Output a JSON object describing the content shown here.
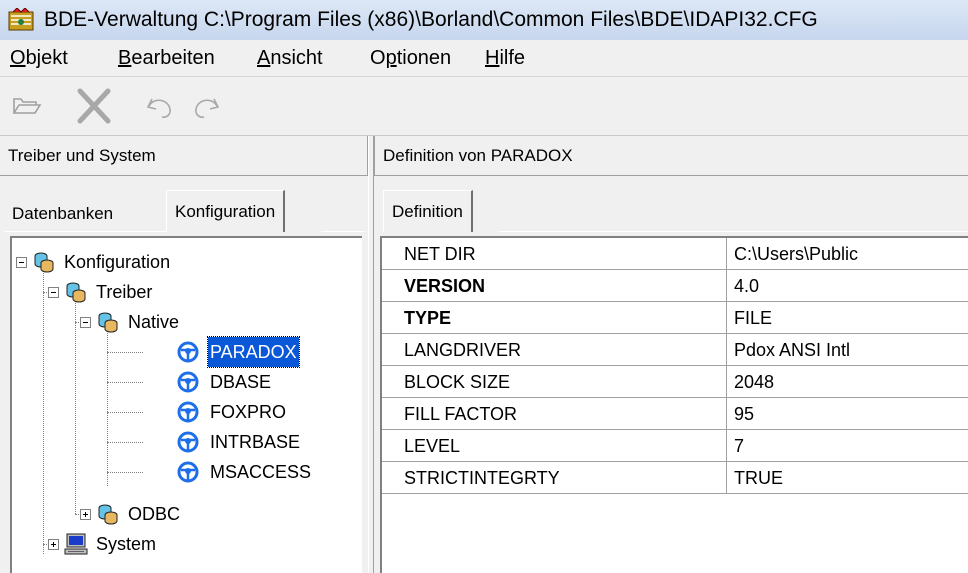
{
  "window": {
    "title": "BDE-Verwaltung  C:\\Program Files (x86)\\Borland\\Common Files\\BDE\\IDAPI32.CFG",
    "app_icon": "bde-app-icon"
  },
  "menu": [
    {
      "accel": "O",
      "rest": "bjekt"
    },
    {
      "accel": "B",
      "rest": "earbeiten"
    },
    {
      "accel": "A",
      "rest": "nsicht"
    },
    {
      "pre": "O",
      "accel": "p",
      "rest": "tionen"
    },
    {
      "accel": "H",
      "rest": "ilfe"
    }
  ],
  "toolbar": {
    "buttons": [
      {
        "name": "open-icon"
      },
      {
        "name": "delete-icon"
      },
      {
        "name": "undo-icon"
      },
      {
        "name": "redo-icon"
      }
    ]
  },
  "left_pane": {
    "header": "Treiber und System",
    "tabs": [
      {
        "label": "Datenbanken",
        "active": false
      },
      {
        "label": "Konfiguration",
        "active": true
      }
    ],
    "tree": [
      {
        "label": "Konfiguration",
        "icon": "database-icon",
        "level": 0,
        "expander": "minus"
      },
      {
        "label": "Treiber",
        "icon": "database-icon",
        "level": 1,
        "expander": "minus"
      },
      {
        "label": "Native",
        "icon": "database-icon",
        "level": 2,
        "expander": "minus"
      },
      {
        "label": "PARADOX",
        "icon": "driver-icon",
        "level": 3,
        "selected": true
      },
      {
        "label": "DBASE",
        "icon": "driver-icon",
        "level": 3
      },
      {
        "label": "FOXPRO",
        "icon": "driver-icon",
        "level": 3
      },
      {
        "label": "INTRBASE",
        "icon": "driver-icon",
        "level": 3
      },
      {
        "label": "MSACCESS",
        "icon": "driver-icon",
        "level": 3
      },
      {
        "label": "ODBC",
        "icon": "database-icon",
        "level": 2,
        "expander": "plus"
      },
      {
        "label": "System",
        "icon": "computer-icon",
        "level": 1,
        "expander": "plus"
      }
    ]
  },
  "right_pane": {
    "header": "Definition von PARADOX",
    "tab": "Definition",
    "rows": [
      {
        "name": "NET DIR",
        "value": "C:\\Users\\Public",
        "bold": false
      },
      {
        "name": "VERSION",
        "value": "4.0",
        "bold": true
      },
      {
        "name": "TYPE",
        "value": "FILE",
        "bold": true
      },
      {
        "name": "LANGDRIVER",
        "value": "Pdox ANSI Intl",
        "bold": false
      },
      {
        "name": "BLOCK SIZE",
        "value": "2048",
        "bold": false
      },
      {
        "name": "FILL FACTOR",
        "value": "95",
        "bold": false
      },
      {
        "name": "LEVEL",
        "value": "7",
        "bold": false
      },
      {
        "name": "STRICTINTEGRTY",
        "value": "TRUE",
        "bold": false
      }
    ]
  },
  "colors": {
    "selection": "#0a58d8",
    "driver_icon": "#1d6ee8",
    "window_bg": "#f0f0f0"
  }
}
